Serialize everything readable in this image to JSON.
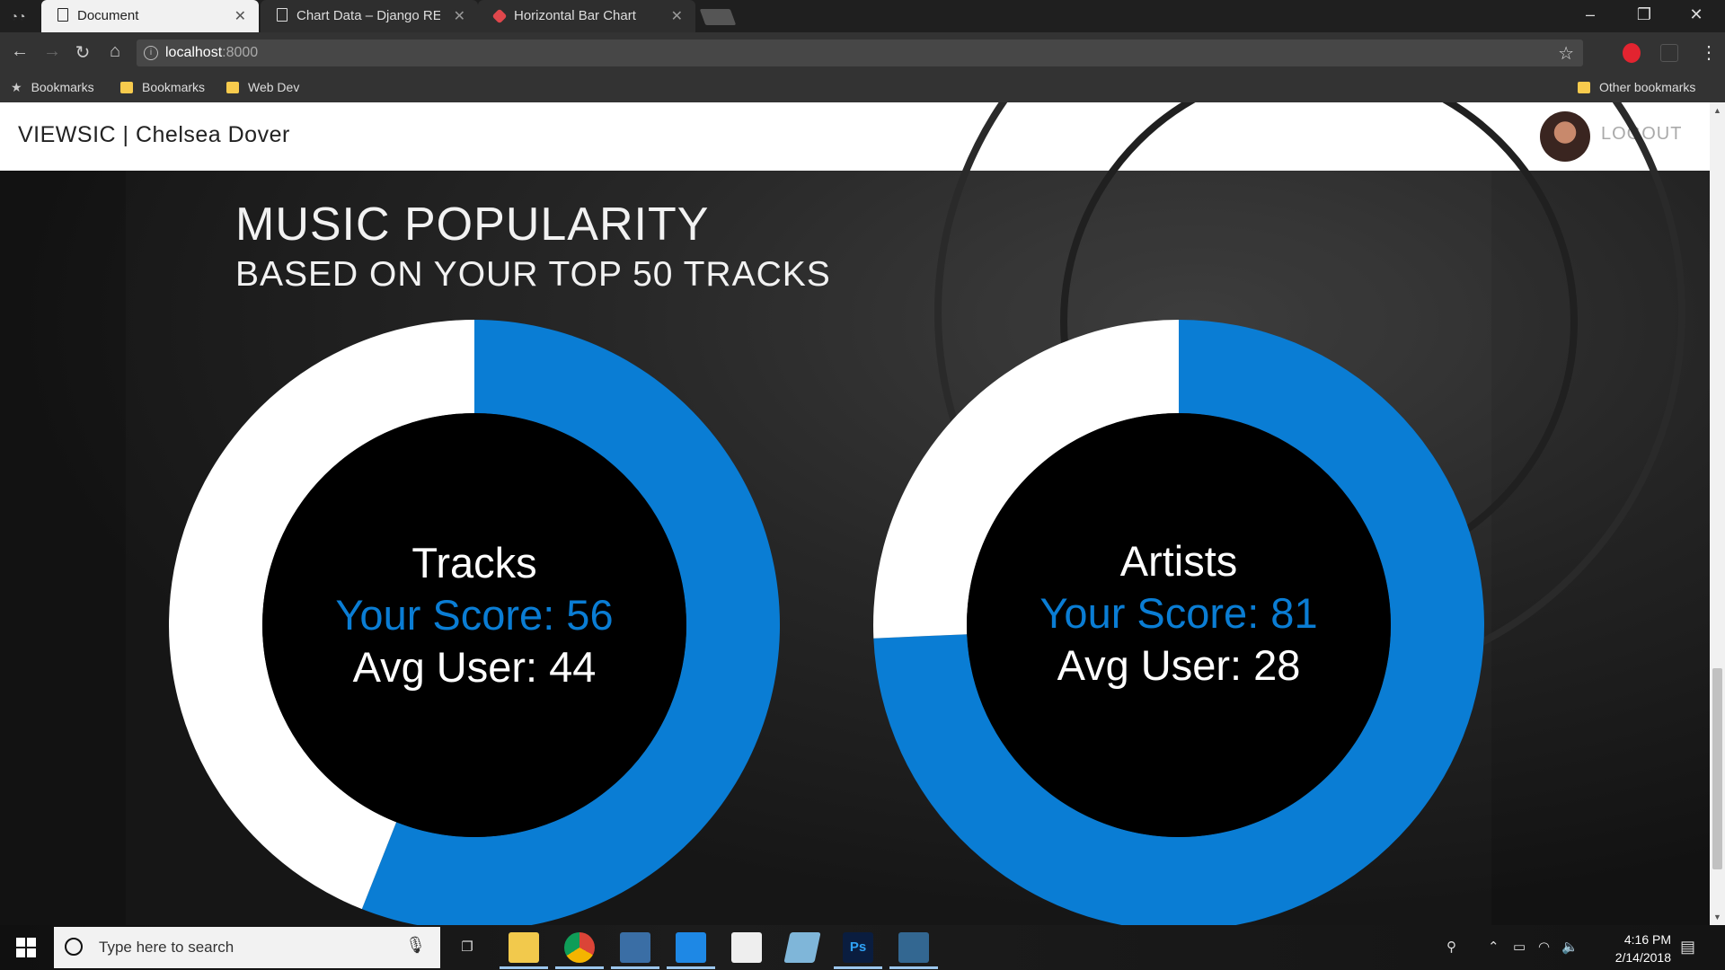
{
  "browser": {
    "tabs": [
      {
        "title": "Document",
        "active": true
      },
      {
        "title": "Chart Data – Django RES",
        "active": false
      },
      {
        "title": "Horizontal Bar Chart",
        "active": false
      }
    ],
    "url_host": "localhost",
    "url_port": ":8000",
    "bookmarks": [
      "Bookmarks",
      "Bookmarks",
      "Web Dev"
    ],
    "other_bookmarks": "Other bookmarks"
  },
  "header": {
    "brand": "VIEWSIC | Chelsea Dover",
    "logout": "LOGOUT"
  },
  "hero": {
    "title": "MUSIC POPULARITY",
    "subtitle": "BASED ON YOUR TOP 50 TRACKS"
  },
  "chart_data": [
    {
      "type": "pie",
      "variant": "donut",
      "label": "Tracks",
      "score_label": "Your Score: 56",
      "avg_label": "Avg User: 44",
      "values": [
        56,
        44
      ],
      "colors": [
        "#0a7dd4",
        "#ffffff"
      ]
    },
    {
      "type": "pie",
      "variant": "donut",
      "label": "Artists",
      "score_label": "Your Score: 81",
      "avg_label": "Avg User: 28",
      "values": [
        81,
        28
      ],
      "colors": [
        "#0a7dd4",
        "#ffffff"
      ]
    }
  ],
  "taskbar": {
    "search_placeholder": "Type here to search",
    "time": "4:16 PM",
    "date": "2/14/2018"
  }
}
